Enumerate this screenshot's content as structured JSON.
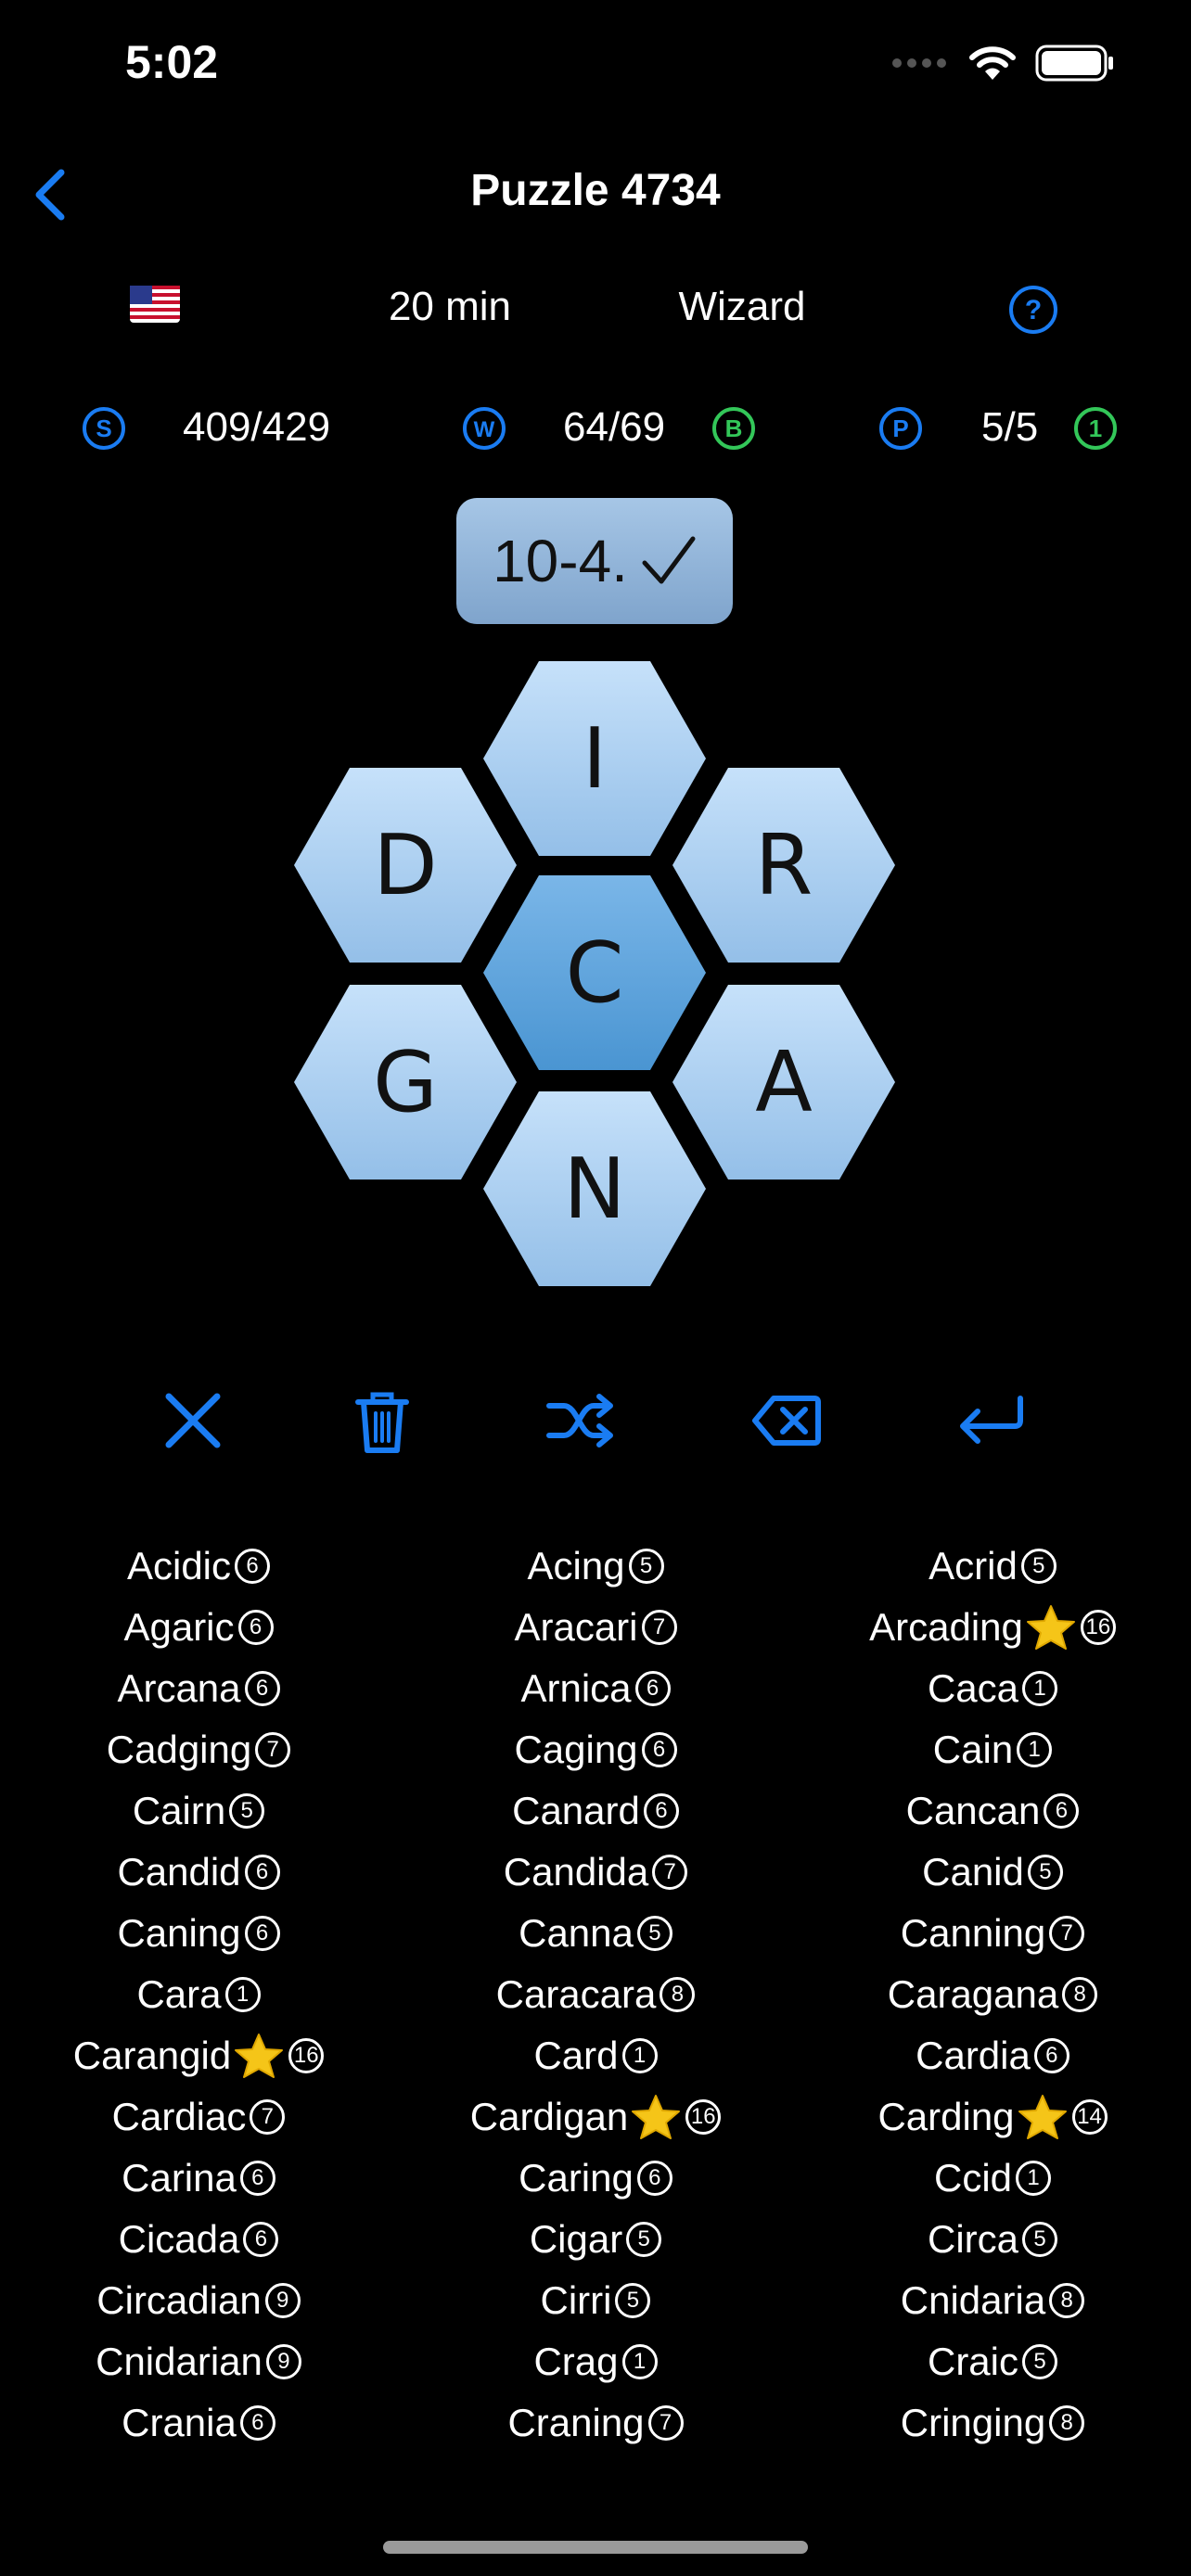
{
  "status": {
    "time": "5:02"
  },
  "header": {
    "title": "Puzzle 4734"
  },
  "info": {
    "time": "20 min",
    "level": "Wizard"
  },
  "stats": {
    "score": "409/429",
    "words": "64/69",
    "pangrams": "5/5"
  },
  "rank": {
    "label": "10-4."
  },
  "letters": {
    "center": "C",
    "top": "I",
    "top_left": "D",
    "top_right": "R",
    "bottom_left": "G",
    "bottom_right": "A",
    "bottom": "N"
  },
  "colors": {
    "accent": "#1a7cf2",
    "green": "#33c759",
    "pill": "#8fb4d9",
    "hex": "#b7d6f4",
    "hex_center": "#5aa2dc"
  },
  "icons": {
    "clear": "x-icon",
    "delete": "trash-icon",
    "shuffle": "shuffle-icon",
    "backspace": "backspace-icon",
    "enter": "return-icon"
  },
  "word_columns": [
    [
      {
        "w": "Acidic",
        "n": "6"
      },
      {
        "w": "Agaric",
        "n": "6"
      },
      {
        "w": "Arcana",
        "n": "6"
      },
      {
        "w": "Cadging",
        "n": "7"
      },
      {
        "w": "Cairn",
        "n": "5"
      },
      {
        "w": "Candid",
        "n": "6"
      },
      {
        "w": "Caning",
        "n": "6"
      },
      {
        "w": "Cara",
        "n": "1"
      },
      {
        "w": "Carangid",
        "n": "16",
        "star": true
      },
      {
        "w": "Cardiac",
        "n": "7"
      },
      {
        "w": "Carina",
        "n": "6"
      },
      {
        "w": "Cicada",
        "n": "6"
      },
      {
        "w": "Circadian",
        "n": "9"
      },
      {
        "w": "Cnidarian",
        "n": "9"
      },
      {
        "w": "Crania",
        "n": "6"
      }
    ],
    [
      {
        "w": "Acing",
        "n": "5"
      },
      {
        "w": "Aracari",
        "n": "7"
      },
      {
        "w": "Arnica",
        "n": "6"
      },
      {
        "w": "Caging",
        "n": "6"
      },
      {
        "w": "Canard",
        "n": "6"
      },
      {
        "w": "Candida",
        "n": "7"
      },
      {
        "w": "Canna",
        "n": "5"
      },
      {
        "w": "Caracara",
        "n": "8"
      },
      {
        "w": "Card",
        "n": "1"
      },
      {
        "w": "Cardigan",
        "n": "16",
        "star": true
      },
      {
        "w": "Caring",
        "n": "6"
      },
      {
        "w": "Cigar",
        "n": "5"
      },
      {
        "w": "Cirri",
        "n": "5"
      },
      {
        "w": "Crag",
        "n": "1"
      },
      {
        "w": "Craning",
        "n": "7"
      }
    ],
    [
      {
        "w": "Acrid",
        "n": "5"
      },
      {
        "w": "Arcading",
        "n": "16",
        "star": true
      },
      {
        "w": "Caca",
        "n": "1"
      },
      {
        "w": "Cain",
        "n": "1"
      },
      {
        "w": "Cancan",
        "n": "6"
      },
      {
        "w": "Canid",
        "n": "5"
      },
      {
        "w": "Canning",
        "n": "7"
      },
      {
        "w": "Caragana",
        "n": "8"
      },
      {
        "w": "Cardia",
        "n": "6"
      },
      {
        "w": "Carding",
        "n": "14",
        "star": true
      },
      {
        "w": "Ccid",
        "n": "1"
      },
      {
        "w": "Circa",
        "n": "5"
      },
      {
        "w": "Cnidaria",
        "n": "8"
      },
      {
        "w": "Craic",
        "n": "5"
      },
      {
        "w": "Cringing",
        "n": "8"
      }
    ]
  ]
}
